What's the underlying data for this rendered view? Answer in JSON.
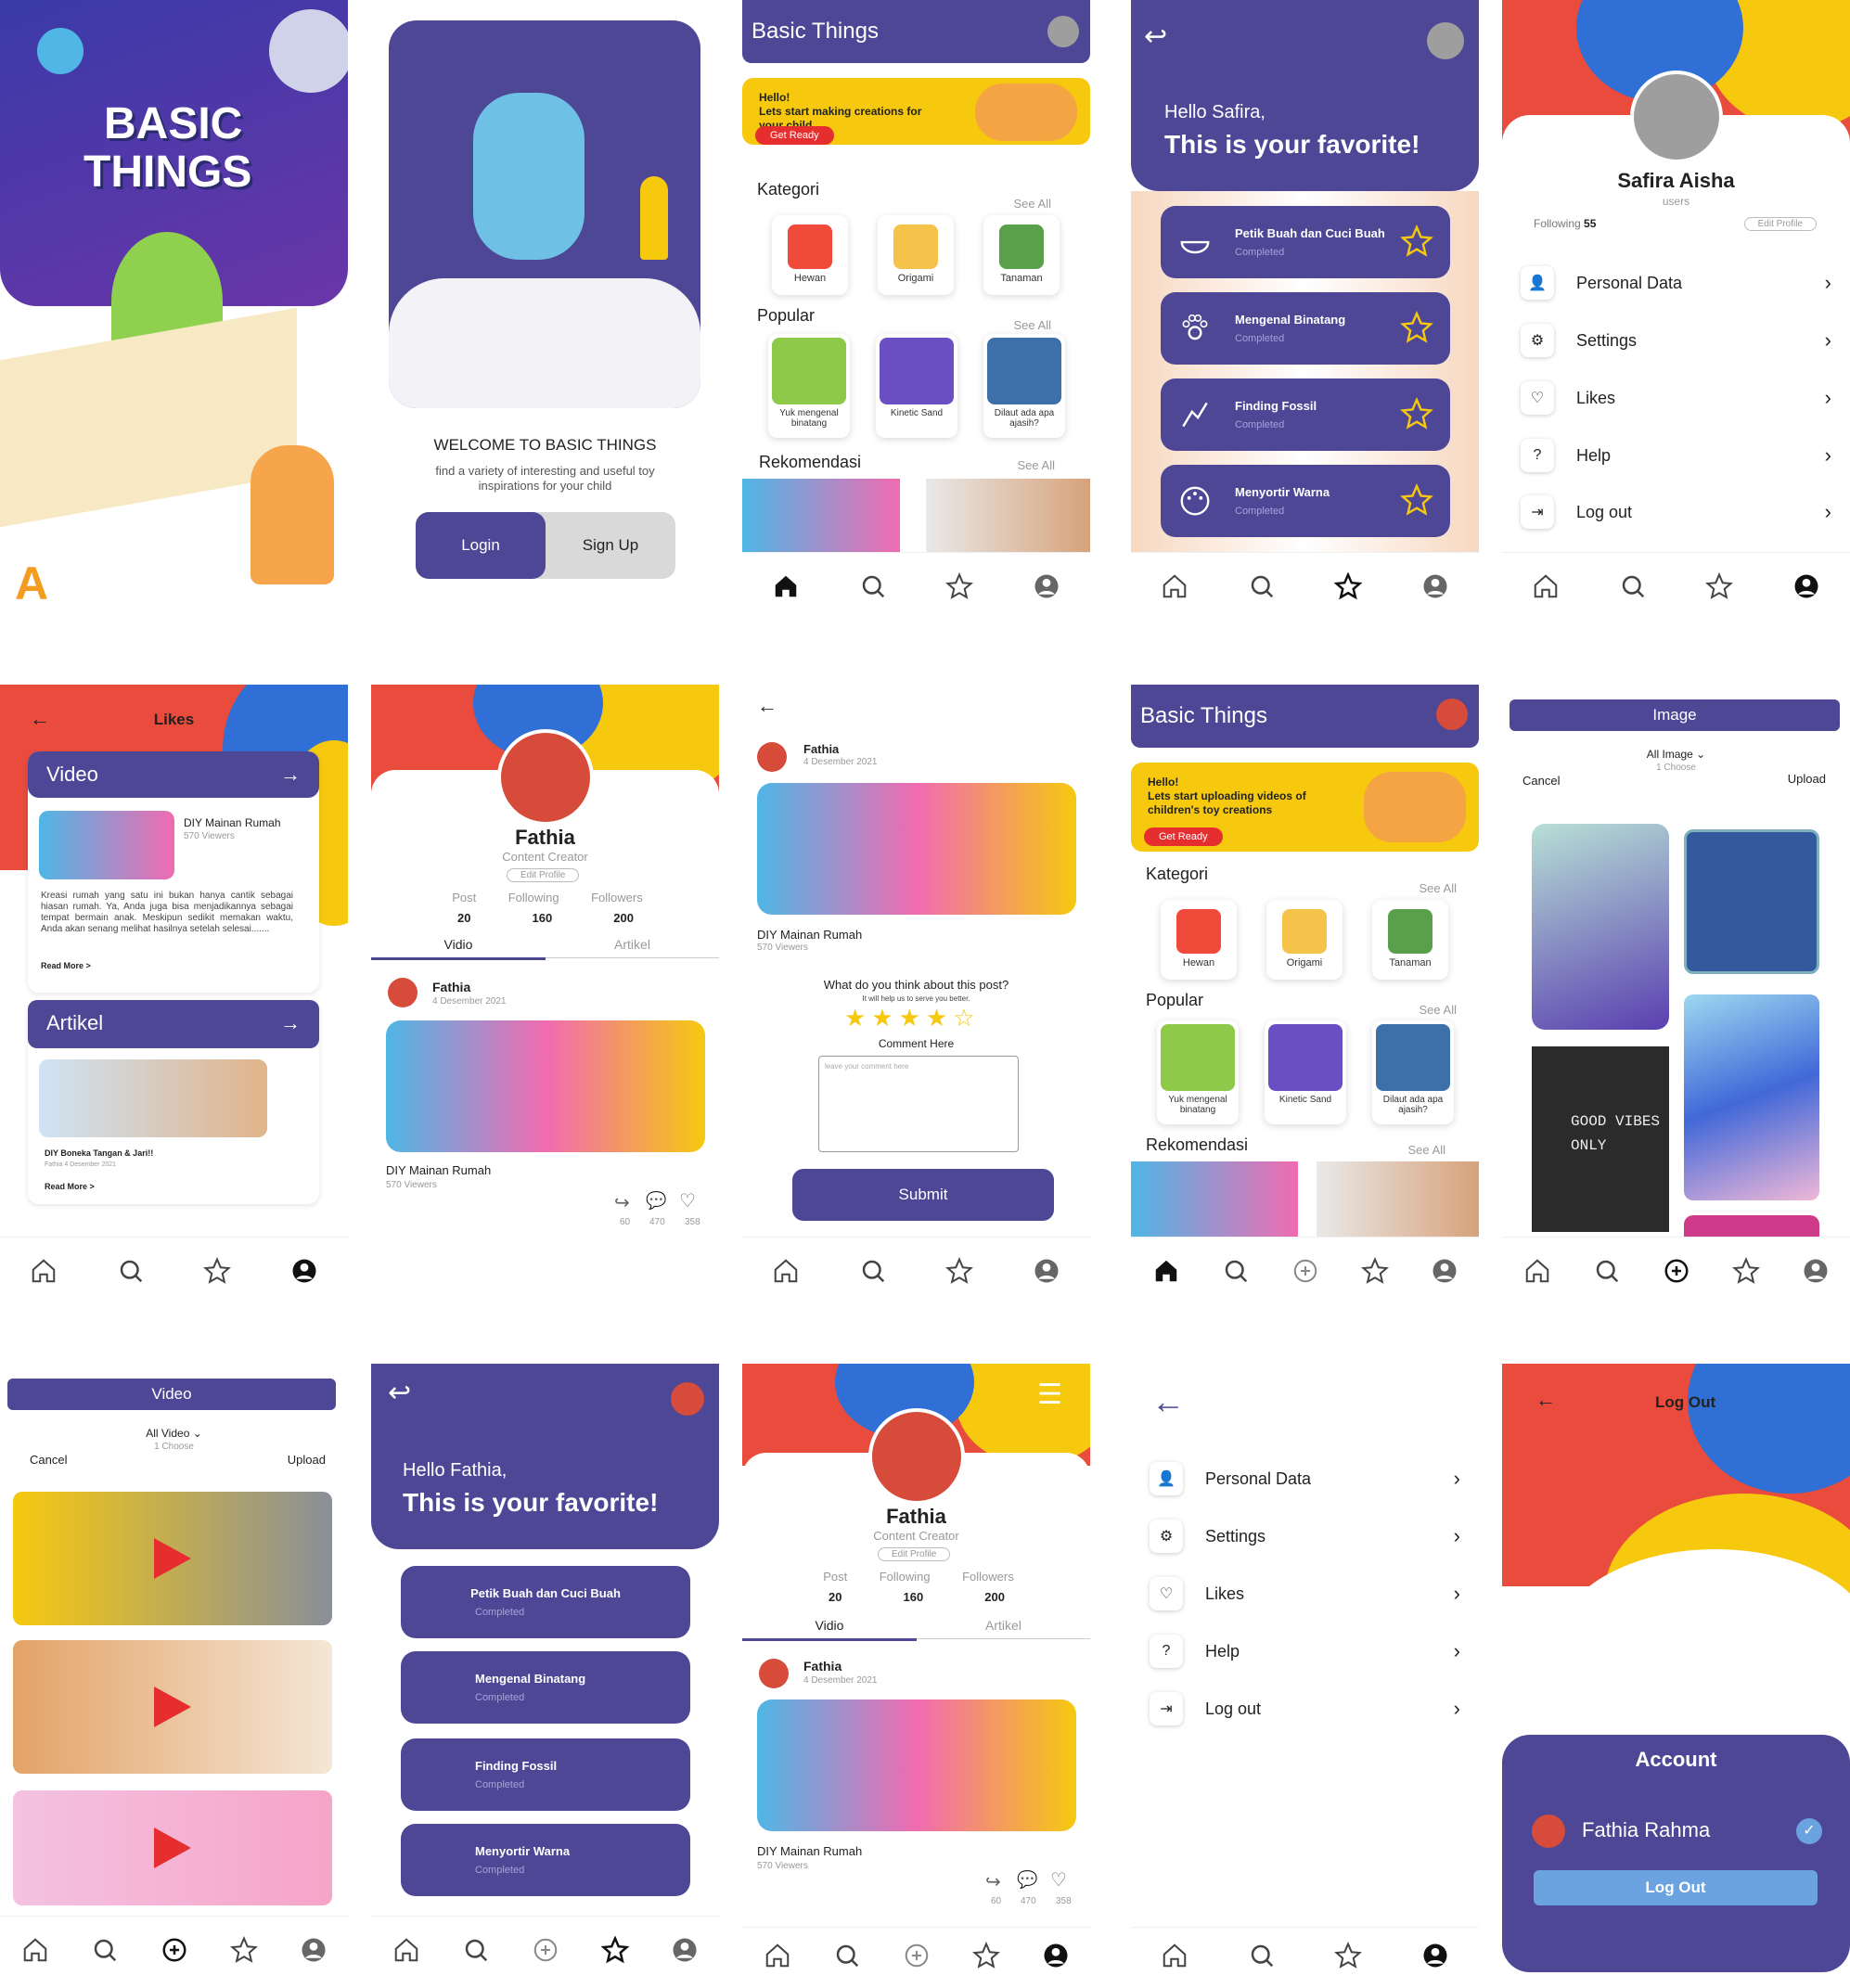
{
  "splash": {
    "title_line1": "BASIC",
    "title_line2": "THINGS"
  },
  "welcome": {
    "title": "WELCOME TO BASIC THINGS",
    "subtitle": "find a variety of interesting and useful toy inspirations for your child",
    "login": "Login",
    "signup": "Sign Up"
  },
  "home": {
    "header": "Basic Things",
    "banner_hello": "Hello!",
    "banner_text": "Lets start making creations for your child",
    "get_ready": "Get Ready",
    "kategori": "Kategori",
    "see_all": "See All",
    "categories": [
      "Hewan",
      "Origami",
      "Tanaman"
    ],
    "popular": "Popular",
    "popular_items": [
      "Yuk mengenal binatang",
      "Kinetic Sand",
      "Dilaut ada apa ajasih?"
    ],
    "rekomendasi": "Rekomendasi"
  },
  "favorite1": {
    "hello": "Hello Safira,",
    "title": "This is your favorite!",
    "items": [
      {
        "title": "Petik Buah dan Cuci Buah",
        "status": "Completed"
      },
      {
        "title": "Mengenal Binatang",
        "status": "Completed"
      },
      {
        "title": "Finding Fossil",
        "status": "Completed"
      },
      {
        "title": "Menyortir Warna",
        "status": "Completed"
      }
    ]
  },
  "profile1": {
    "name": "Safira Aisha",
    "role": "users",
    "following_label": "Following",
    "following": "55",
    "edit": "Edit Profile",
    "menu": [
      "Personal Data",
      "Settings",
      "Likes",
      "Help",
      "Log out"
    ]
  },
  "likes": {
    "title": "Likes",
    "video": "Video",
    "video_title": "DIY Mainan Rumah",
    "video_views": "570 Viewers",
    "desc": "Kreasi rumah yang satu ini bukan hanya cantik sebagai hiasan rumah. Ya, Anda juga bisa menjadikannya sebagai tempat bermain anak. Meskipun sedikit memakan waktu, Anda akan senang melihat hasilnya setelah selesai.......",
    "read_more": "Read More >",
    "artikel": "Artikel",
    "art_title": "DIY Boneka Tangan & Jari!!",
    "art_meta": "Fathia  4 Desember 2021"
  },
  "creator": {
    "name": "Fathia",
    "role": "Content Creator",
    "edit": "Edit Profile",
    "post_label": "Post",
    "following_label": "Following",
    "followers_label": "Followers",
    "post": "20",
    "following": "160",
    "followers": "200",
    "tab_video": "Vidio",
    "tab_artikel": "Artikel",
    "author": "Fathia",
    "date": "4 Desember 2021",
    "vtitle": "DIY Mainan Rumah",
    "views": "570 Viewers",
    "shares": "60",
    "comments": "470",
    "likes": "358"
  },
  "comment": {
    "author": "Fathia",
    "date": "4 Desember 2021",
    "vtitle": "DIY Mainan Rumah",
    "views": "570 Viewers",
    "question": "What do you think about this post?",
    "help": "It will help us to serve you better.",
    "comment_here": "Comment Here",
    "placeholder": "leave your comment here",
    "submit": "Submit"
  },
  "home2": {
    "header": "Basic Things",
    "banner_hello": "Hello!",
    "banner_text": "Lets start uploading videos of children's toy creations",
    "get_ready": "Get Ready"
  },
  "imageup": {
    "title": "Image",
    "filter": "All Image",
    "choose": "1 Choose",
    "cancel": "Cancel",
    "upload": "Upload",
    "sign": "GOOD VIBES ONLY"
  },
  "videoup": {
    "title": "Video",
    "filter": "All Video",
    "choose": "1 Choose",
    "cancel": "Cancel",
    "upload": "Upload"
  },
  "favorite2": {
    "hello": "Hello Fathia,",
    "title": "This is your favorite!"
  },
  "creator2": {
    "tab_video": "Vidio"
  },
  "settings": {
    "menu": [
      "Personal Data",
      "Settings",
      "Likes",
      "Help",
      "Log out"
    ]
  },
  "logout": {
    "title": "Log Out",
    "account": "Account",
    "name": "Fathia Rahma",
    "button": "Log Out"
  },
  "colors": {
    "purple": "#4d4796",
    "yellow": "#f6c90f",
    "red": "#e62e2e",
    "blue_light": "#6aa3e0"
  }
}
